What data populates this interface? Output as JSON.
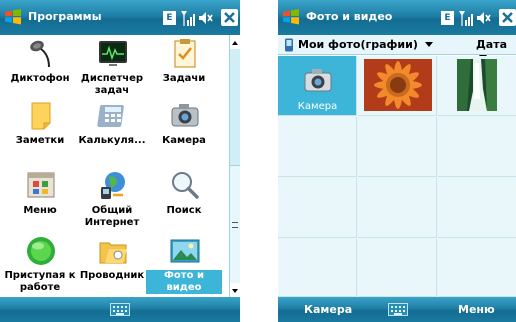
{
  "left_screen": {
    "title": "Программы",
    "tray": {
      "network": "E"
    },
    "programs": [
      {
        "label": "Диктофон",
        "icon": "microphone-icon"
      },
      {
        "label": "Диспетчер задач",
        "icon": "task-manager-icon"
      },
      {
        "label": "Задачи",
        "icon": "tasks-clipboard-icon"
      },
      {
        "label": "Заметки",
        "icon": "notes-icon"
      },
      {
        "label": "Калькуля...",
        "icon": "calculator-icon"
      },
      {
        "label": "Камера",
        "icon": "camera-icon"
      },
      {
        "label": "Меню",
        "icon": "menu-window-icon"
      },
      {
        "label": "Общий Интернет",
        "icon": "internet-sharing-icon"
      },
      {
        "label": "Поиск",
        "icon": "magnifier-icon"
      },
      {
        "label": "Приступая к работе",
        "icon": "getting-started-icon"
      },
      {
        "label": "Проводник",
        "icon": "explorer-folder-icon"
      },
      {
        "label": "Фото и видео",
        "icon": "pictures-icon",
        "selected": true
      }
    ]
  },
  "right_screen": {
    "title": "Фото и видео",
    "tray": {
      "network": "E"
    },
    "folder": "Мои фото(графии)",
    "sort": "Дата",
    "grid": [
      {
        "kind": "camera",
        "label": "Камера",
        "selected": true
      },
      {
        "kind": "photo",
        "subject": "flower"
      },
      {
        "kind": "photo",
        "subject": "waterfall"
      }
    ],
    "softkeys": {
      "left": "Камера",
      "right": "Меню"
    }
  },
  "colors": {
    "titlebar": "#1f7fa6",
    "selection": "#3db5d8",
    "background": "#ffffff"
  }
}
